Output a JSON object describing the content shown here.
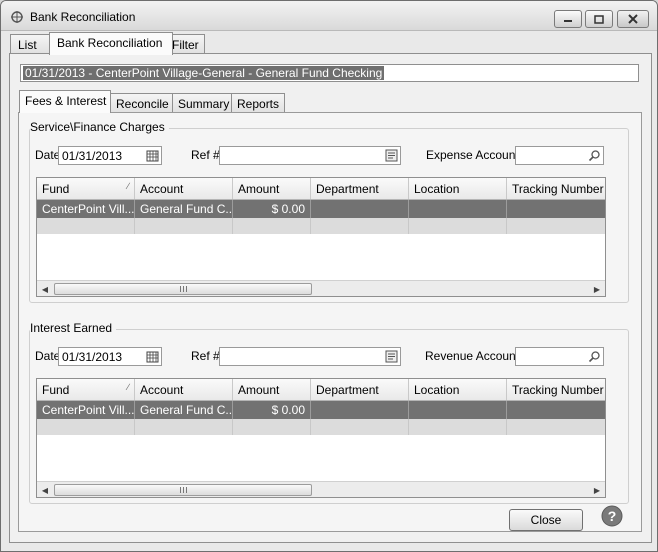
{
  "window": {
    "title": "Bank Reconciliation",
    "controls": [
      "minimize-icon",
      "maximize-icon",
      "close-icon"
    ]
  },
  "top_tabs": [
    {
      "label": "List",
      "active": false
    },
    {
      "label": "Bank Reconciliation",
      "active": true
    },
    {
      "label": "Filter",
      "active": false
    }
  ],
  "account_bar": "01/31/2013 - CenterPoint Village-General - General Fund Checking",
  "inner_tabs": [
    {
      "label": "Fees & Interest",
      "active": true
    },
    {
      "label": "Reconcile",
      "active": false
    },
    {
      "label": "Summary",
      "active": false
    },
    {
      "label": "Reports",
      "active": false
    }
  ],
  "service": {
    "title": "Service\\Finance Charges",
    "date_label": "Date",
    "date_value": "01/31/2013",
    "ref_label": "Ref #",
    "ref_value": "",
    "account_label": "Expense Account",
    "account_value": "",
    "columns": [
      "Fund",
      "Account",
      "Amount",
      "Department",
      "Location",
      "Tracking Number"
    ],
    "rows": [
      {
        "fund": "CenterPoint Vill...",
        "account": "General Fund C...",
        "amount": "$ 0.00",
        "department": "",
        "location": "",
        "tracking": ""
      }
    ]
  },
  "interest": {
    "title": "Interest Earned",
    "date_label": "Date",
    "date_value": "01/31/2013",
    "ref_label": "Ref #",
    "ref_value": "",
    "account_label": "Revenue Account",
    "account_value": "",
    "columns": [
      "Fund",
      "Account",
      "Amount",
      "Department",
      "Location",
      "Tracking Number"
    ],
    "rows": [
      {
        "fund": "CenterPoint Vill...",
        "account": "General Fund C...",
        "amount": "$ 0.00",
        "department": "",
        "location": "",
        "tracking": ""
      }
    ]
  },
  "buttons": {
    "close": "Close"
  },
  "icons": {
    "app": "bank-reconciliation-icon",
    "calendar": "calendar-icon",
    "lookup": "search-icon",
    "help": "help-icon"
  },
  "colors": {
    "selected_row": "#727272",
    "empty_row": "#dcdcdc",
    "help_circle": "#7a7a7a"
  }
}
